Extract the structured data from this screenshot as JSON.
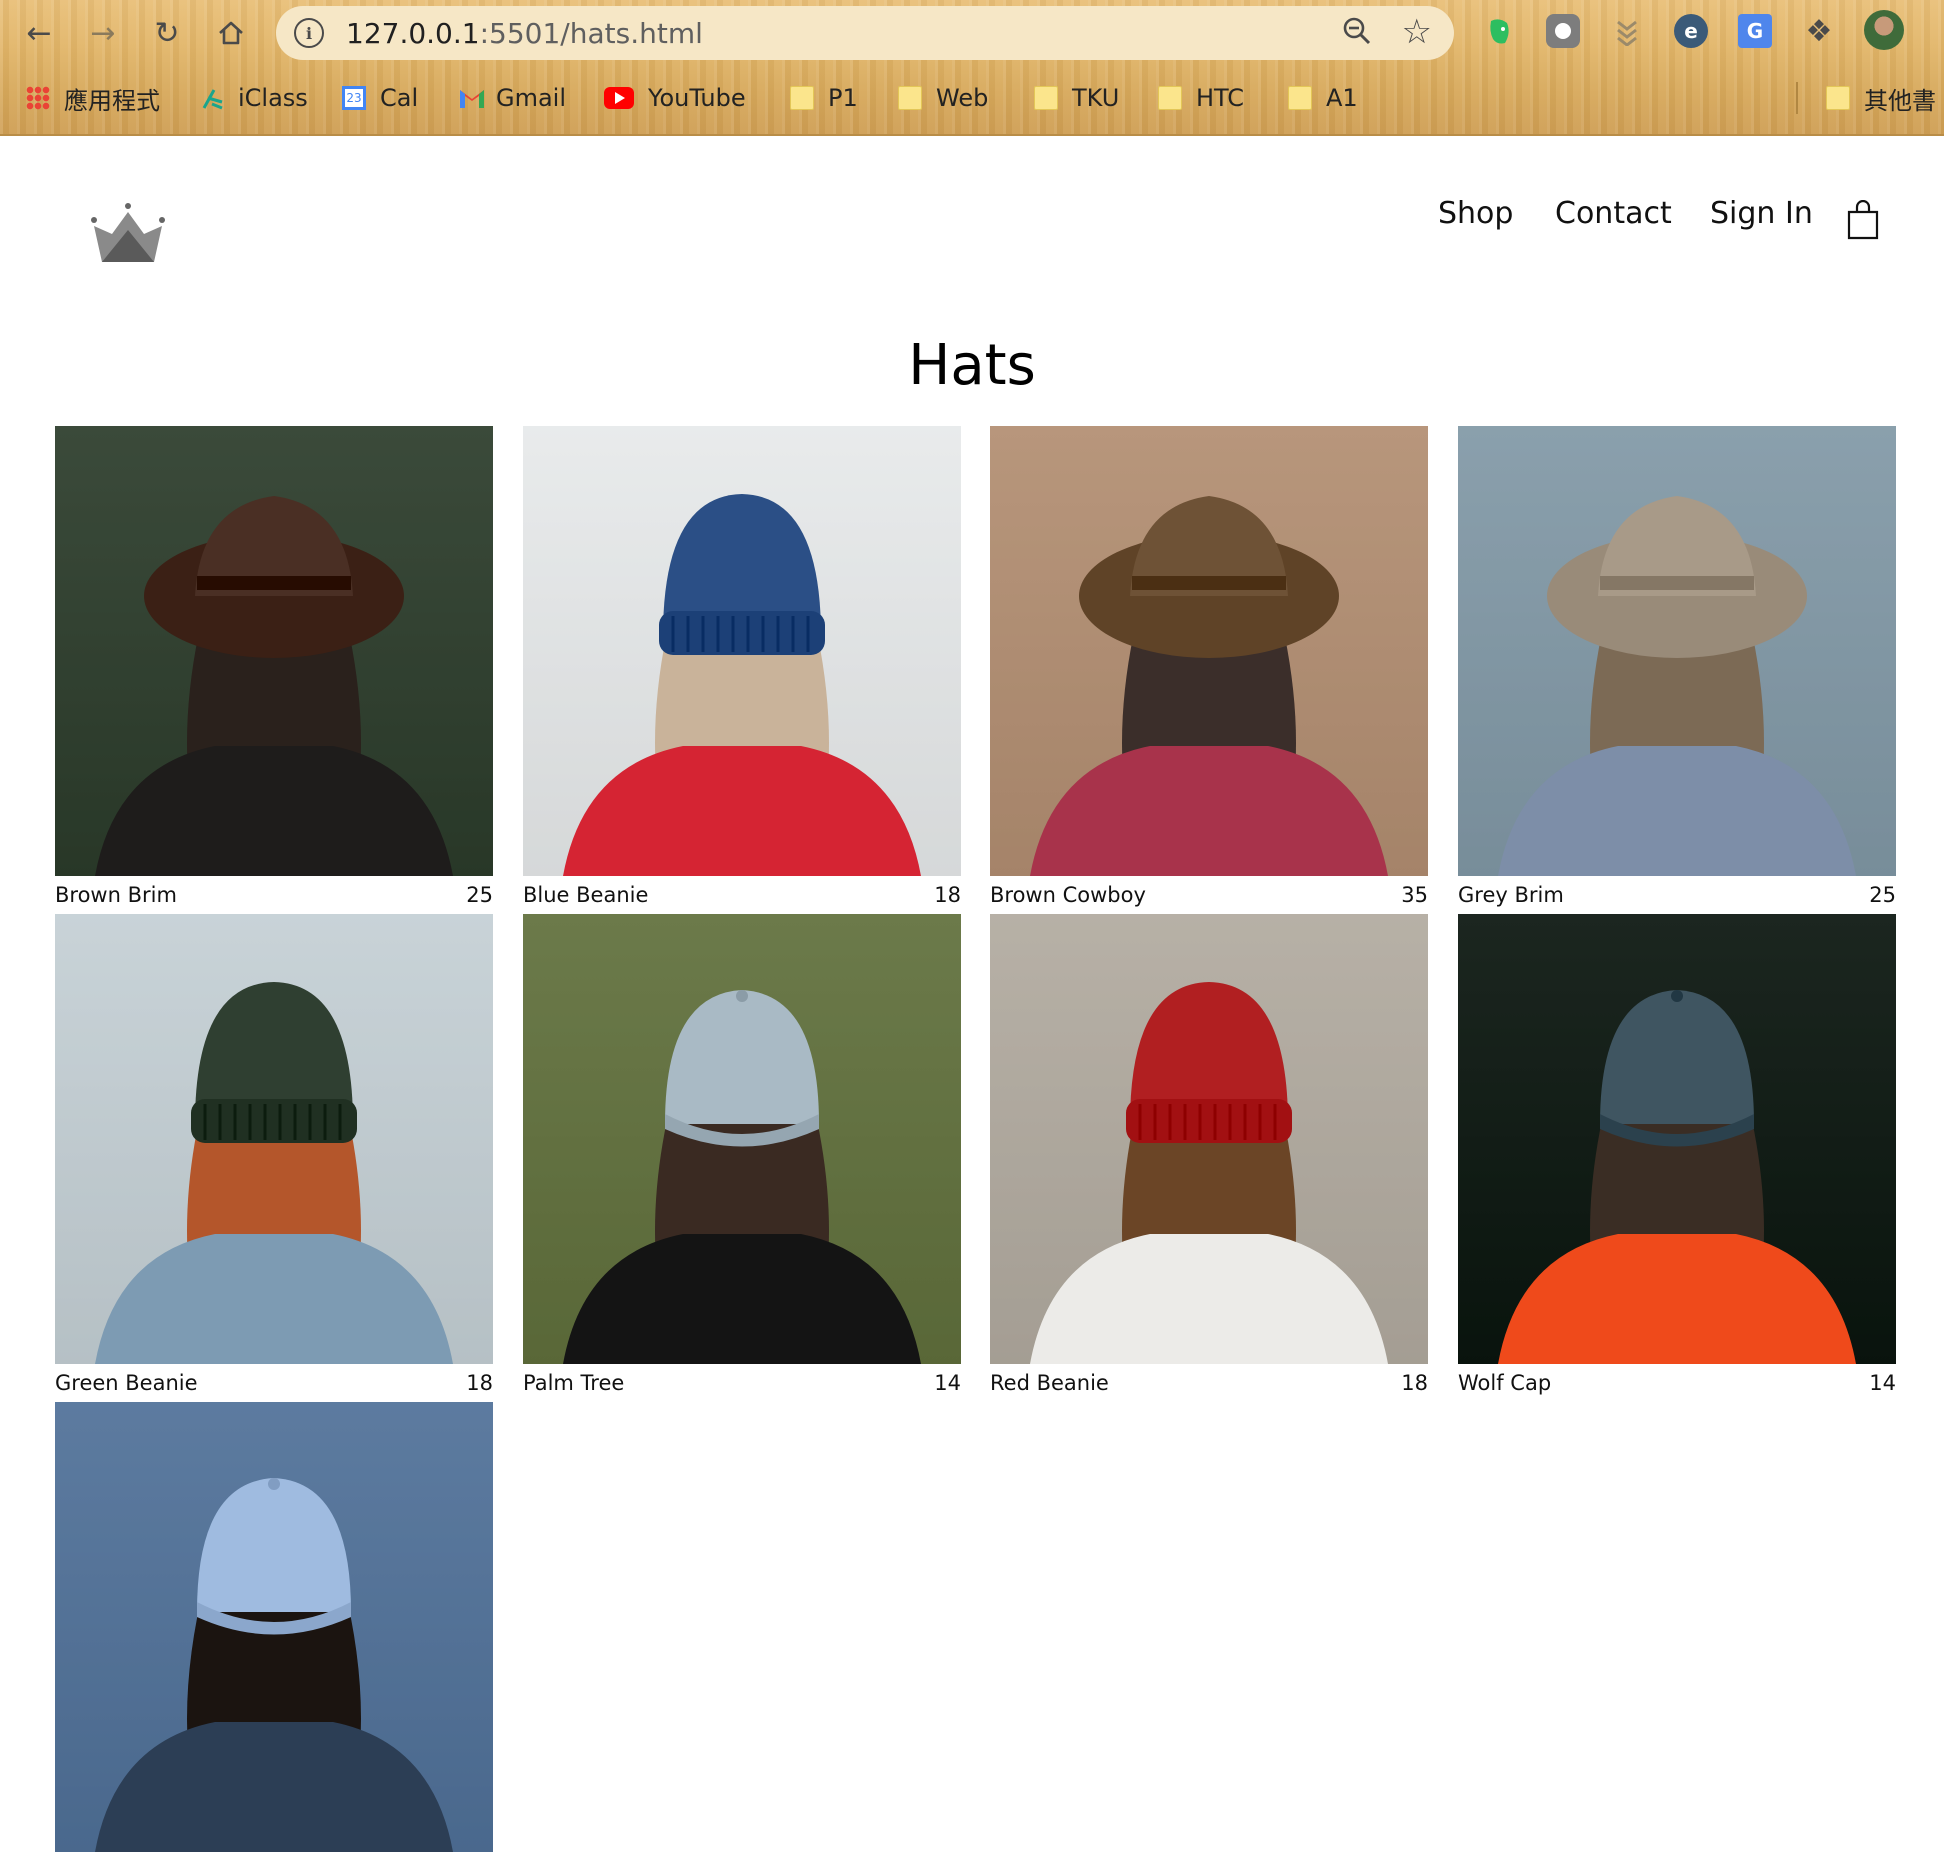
{
  "browser": {
    "url_host": "127.0.0.1",
    "url_path": ":5501/hats.html",
    "bookmarks": [
      "應用程式",
      "iClass",
      "Cal",
      "Gmail",
      "YouTube",
      "P1",
      "Web",
      "TKU",
      "HTC",
      "A1",
      "其他書"
    ],
    "cal_badge": "23"
  },
  "header": {
    "nav": [
      "Shop",
      "Contact",
      "Sign In"
    ]
  },
  "page": {
    "title": "Hats"
  },
  "products": [
    {
      "name": "Brown Brim",
      "price": "25",
      "hat_color": "#4a2f24",
      "hat_style": "fedora",
      "bg": "#3b4a3a",
      "hair": "#2a211c",
      "body": "#1e1c1b"
    },
    {
      "name": "Blue Beanie",
      "price": "18",
      "hat_color": "#2b4f86",
      "hat_style": "beanie",
      "bg": "#e9ebec",
      "hair": "#c9b39a",
      "body": "#d52433"
    },
    {
      "name": "Brown Cowboy",
      "price": "35",
      "hat_color": "#6e5236",
      "hat_style": "fedora",
      "bg": "#b8967c",
      "hair": "#3b2e2a",
      "body": "#a8334b"
    },
    {
      "name": "Grey Brim",
      "price": "25",
      "hat_color": "#a89a88",
      "hat_style": "fedora",
      "bg": "#8aa0ad",
      "hair": "#7c6a55",
      "body": "#7d8ea8"
    },
    {
      "name": "Green Beanie",
      "price": "18",
      "hat_color": "#2f3f31",
      "hat_style": "beanie",
      "bg": "#c9d3d8",
      "hair": "#b4562b",
      "body": "#7d9bb3"
    },
    {
      "name": "Palm Tree",
      "price": "14",
      "hat_color": "#a9bac5",
      "hat_style": "cap",
      "bg": "#6c7a4a",
      "hair": "#3a2a22",
      "body": "#141414"
    },
    {
      "name": "Red Beanie",
      "price": "18",
      "hat_color": "#b11f21",
      "hat_style": "beanie",
      "bg": "#b7b1a6",
      "hair": "#6b4526",
      "body": "#ecebe8"
    },
    {
      "name": "Wolf Cap",
      "price": "14",
      "hat_color": "#3f5561",
      "hat_style": "cap",
      "bg": "#1c2620",
      "hair": "#3a2d24",
      "body": "#ef4a1b"
    },
    {
      "name": "",
      "price": "",
      "hat_color": "#9fbbe0",
      "hat_style": "cap",
      "bg": "#5d7ba0",
      "hair": "#1b1410",
      "body": "#2c3e55"
    }
  ]
}
